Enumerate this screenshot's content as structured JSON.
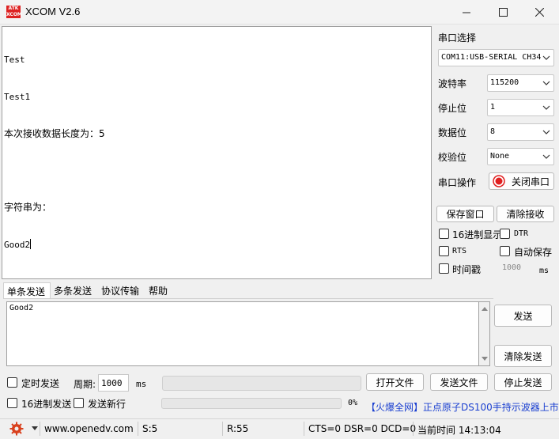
{
  "window": {
    "title": "XCOM V2.6",
    "logo_text": "ATK XCOM"
  },
  "receive": {
    "lines": [
      "Test",
      "Test1",
      "本次接收数据长度为：5",
      "",
      "字符串为：",
      "Good2"
    ]
  },
  "panel": {
    "port_select_label": "串口选择",
    "port_value": "COM11:USB-SERIAL CH34",
    "baud_label": "波特率",
    "baud_value": "115200",
    "stop_label": "停止位",
    "stop_value": "1",
    "data_label": "数据位",
    "data_value": "8",
    "parity_label": "校验位",
    "parity_value": "None",
    "port_op_label": "串口操作",
    "close_port_label": "关闭串口",
    "save_window_label": "保存窗口",
    "clear_recv_label": "清除接收",
    "hex_display_label": "16进制显示",
    "dtr_label": "DTR",
    "rts_label": "RTS",
    "auto_save_label": "自动保存",
    "timestamp_label": "时间戳",
    "timestamp_value": "1000",
    "ms_label": "ms"
  },
  "tabs": [
    "单条发送",
    "多条发送",
    "协议传输",
    "帮助"
  ],
  "send": {
    "text": "Good2",
    "send_label": "发送",
    "clear_send_label": "清除发送",
    "timed_send_label": "定时发送",
    "period_label": "周期:",
    "period_value": "1000",
    "ms_label": "ms",
    "open_file_label": "打开文件",
    "send_file_label": "发送文件",
    "stop_send_label": "停止发送",
    "hex_send_label": "16进制发送",
    "send_newline_label": "发送新行",
    "progress_text": "0%",
    "progress_value": 0,
    "ad_text": "【火爆全网】正点原子DS100手持示波器上市"
  },
  "status": {
    "website": "www.openedv.com",
    "sent": "S:5",
    "received": "R:55",
    "lines_status": "CTS=0 DSR=0 DCD=0",
    "time_label": "当前时间 14:13:04"
  },
  "colors": {
    "close_port_indicator": "#e02020",
    "ad_link": "#1a3fd0",
    "gear": "#d9411e"
  }
}
